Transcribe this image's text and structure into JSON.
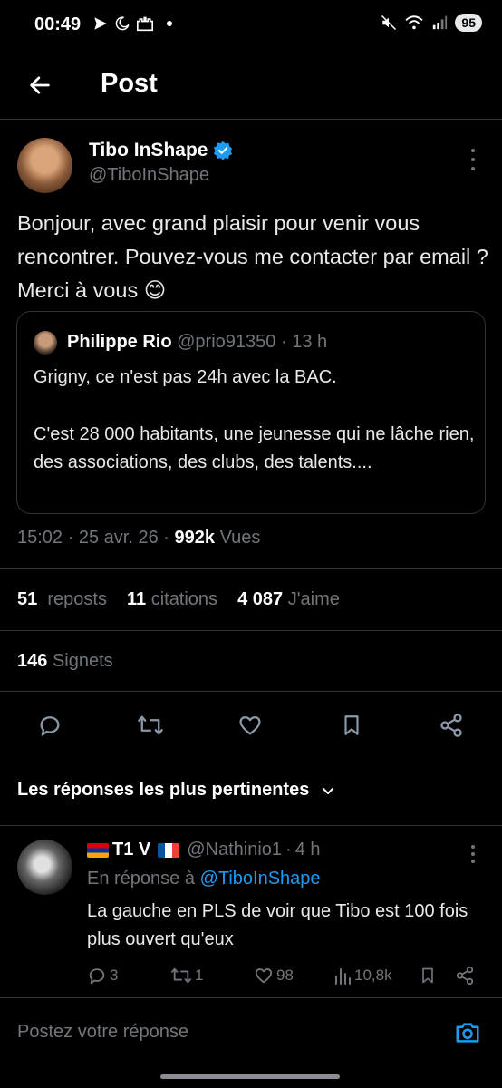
{
  "status_bar": {
    "time": "00:49",
    "battery": "95",
    "left_icons": [
      "send-icon",
      "moon-icon",
      "castle-icon",
      "dot-icon"
    ],
    "right_icons": [
      "mute-icon",
      "wifi-icon",
      "signal-icon"
    ]
  },
  "nav": {
    "title": "Post"
  },
  "tweet": {
    "author_name": "Tibo InShape",
    "author_handle": "@TiboInShape",
    "text": "Bonjour, avec grand plaisir pour venir vous rencontrer. Pouvez-vous me contacter par email ? Merci à vous 😊",
    "time": "15:02",
    "date": "25 avr. 26",
    "views_count": "992k",
    "views_label": "Vues",
    "sep": "·"
  },
  "quote": {
    "name": "Philippe Rio",
    "handle": "@prio91350",
    "age": "13 h",
    "sep": "·",
    "line1": "Grigny, ce n'est pas 24h avec la BAC.",
    "line2": "C'est 28 000 habitants, une jeunesse qui ne lâche rien, des associations, des clubs, des talents...."
  },
  "stats": {
    "reposts_count": "51",
    "reposts_label": "reposts",
    "citations_count": "11",
    "citations_label": "citations",
    "likes_count": "4 087",
    "likes_label": "J'aime",
    "bookmarks_count": "146",
    "bookmarks_label": "Signets"
  },
  "replies_section": {
    "title": "Les réponses les plus pertinentes"
  },
  "reply": {
    "name": "T1 V",
    "handle": "@Nathinio1",
    "age": "4 h",
    "sep": "·",
    "in_reply_prefix": "En réponse à",
    "in_reply_handle": "@TiboInShape",
    "text": "La gauche en PLS de voir que Tibo est 100 fois plus ouvert qu'eux",
    "replies": "3",
    "reposts": "1",
    "likes": "98",
    "views": "10,8k"
  },
  "composer": {
    "placeholder": "Postez votre réponse"
  },
  "colors": {
    "accent": "#1d9bf0",
    "muted": "#71767b",
    "background": "#000000",
    "divider": "#2f3336"
  }
}
